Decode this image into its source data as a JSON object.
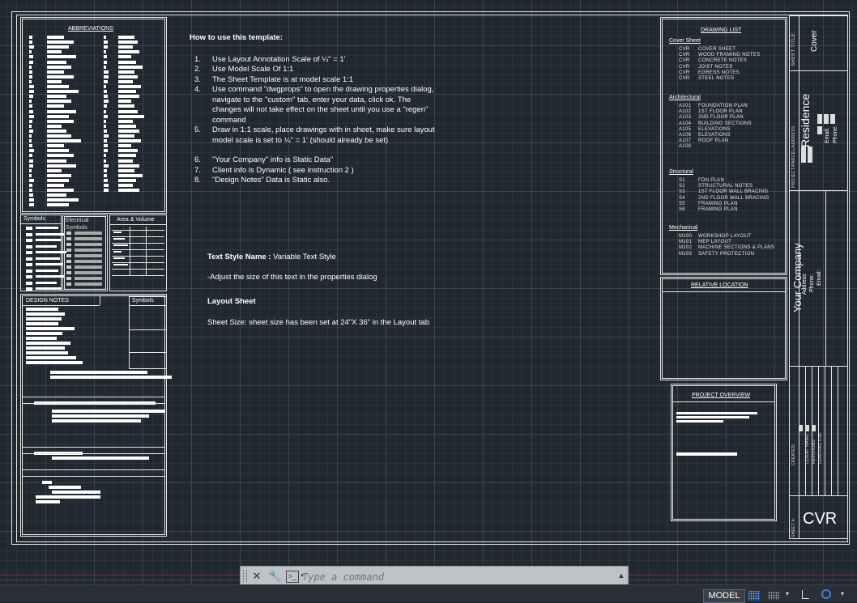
{
  "sheet": {
    "abbreviations_title": "ABBREVIATIONS",
    "symbols_title": "Symbols",
    "electrical_title": "Electrical Symbols",
    "area_volume_title": "Area & Volume",
    "design_notes_title": "DESIGN NOTES",
    "symbols_title_2": "Symbols"
  },
  "instructions": {
    "heading": "How to use this template:",
    "items": [
      {
        "num": "1.",
        "text": "Use Layout Annotation Scale of ¼\" = 1'"
      },
      {
        "num": "2.",
        "text": "Use Model Scale Of 1:1"
      },
      {
        "num": "3.",
        "text": "The Sheet Template is at model scale 1:1"
      },
      {
        "num": "4.",
        "text": "Use command \"dwgprops\" to open the drawing properties dialog, navigate to the \"custom\" tab, enter your data, click ok. The changes will not take effect on the sheet until you use a \"regen\" command"
      },
      {
        "num": "5.",
        "text": "Draw in 1:1 scale, place drawings with in sheet, make sure layout model scale is set to ¼\" = 1' (should already be set)"
      },
      {
        "num": "6.",
        "text": "\"Your Company\" info is Static Data\""
      },
      {
        "num": "7.",
        "text": "Client info is Dynamic ( see instruction 2 )"
      },
      {
        "num": "8.",
        "text": "\"Design Notes\" Data is Static also."
      }
    ]
  },
  "text_style": {
    "label": "Text Style Name :",
    "value": " Variable Text Style",
    "note": "-Adjust the size of this text in the properties dialog",
    "layout_heading": "Layout Sheet",
    "sheet_size": "Sheet Size: sheet size has been set at 24\"X 36\" in the Layout tab"
  },
  "drawing_list": {
    "title": "DRAWING LIST",
    "groups": [
      {
        "name": "Cover Sheet",
        "items": [
          [
            "CVR",
            "COVER SHEET"
          ],
          [
            "CVR",
            "WOOD FRAMING NOTES"
          ],
          [
            "CVR",
            "CONCRETE NOTES"
          ],
          [
            "CVR",
            "JOIST NOTES"
          ],
          [
            "CVR",
            "EGRESS NOTES"
          ],
          [
            "CVR",
            "STEEL NOTES"
          ]
        ]
      },
      {
        "name": "Architectural",
        "items": [
          [
            "A101",
            "FOUNDATION PLAN"
          ],
          [
            "A102",
            "1ST FLOOR PLAN"
          ],
          [
            "A103",
            "2ND FLOOR PLAN"
          ],
          [
            "A104",
            "BUILDING SECTIONS"
          ],
          [
            "A105",
            "ELEVATIONS"
          ],
          [
            "A106",
            "ELEVATIONS"
          ],
          [
            "A107",
            "ROOF PLAN"
          ],
          [
            "A108",
            ""
          ]
        ]
      },
      {
        "name": "Structural",
        "items": [
          [
            "S1",
            "FDN PLAN"
          ],
          [
            "S2",
            "STRUCTURAL NOTES"
          ],
          [
            "S3",
            "1ST FLOOR WALL BRACING"
          ],
          [
            "S4",
            "2ND FLOOR WALL BRACING"
          ],
          [
            "S5",
            "FRAMING PLAN"
          ],
          [
            "S6",
            "FRAMING PLAN"
          ]
        ]
      },
      {
        "name": "Mechanical",
        "items": [
          [
            "M100",
            "WORKSHOP LAYOUT"
          ],
          [
            "M101",
            "MEP LAYOUT"
          ],
          [
            "M102",
            "MACHINE SECTIONS & PLANS"
          ],
          [
            "M103",
            "SAFETY PROTECTION"
          ]
        ]
      }
    ]
  },
  "relative_location": {
    "title": "RELATIVE LOCATION"
  },
  "project_overview": {
    "title": "PROJECT OVERVIEW"
  },
  "title_block": {
    "sheet_title_label": "SHEET TITLE:",
    "sheet_title": "Cover",
    "project_label": "PROJECT/PARCEL/ADDRESS:",
    "project_name": "Residence",
    "client_email": "Email:",
    "client_phone": "Phone:",
    "company": "Your Company",
    "company_address": "Address",
    "company_phone": "Phone:",
    "company_email": "Email:",
    "created_label": "CREATED:",
    "created_fields": [
      "CLIENT NAME:",
      "REVISIONS:",
      "CONTRACTOR:"
    ],
    "sheet_no_label": "SHEET #:",
    "sheet_no": "CVR"
  },
  "command": {
    "placeholder": "Type a command"
  },
  "status": {
    "model": "MODEL"
  }
}
